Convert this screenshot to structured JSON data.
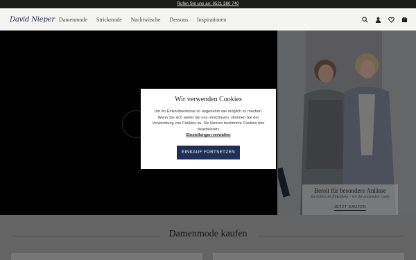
{
  "topbar": {
    "text": "Rufen Sie uns an: 0521 380 740"
  },
  "nav": {
    "logo": "David Nieper",
    "items": [
      "Damenmode",
      "Strickmode",
      "Nachtwäsche",
      "Dessous",
      "Inspirationen"
    ],
    "icons": [
      "search-icon",
      "account-icon",
      "wishlist-icon",
      "cart-icon"
    ]
  },
  "promo": {
    "title": "Bereit für besondere Anlässe",
    "subtitle": "Sie haben die Einladung – wir die passenden Looks",
    "cta": "JETZT KAUFEN"
  },
  "section": {
    "title": "Damenmode kaufen"
  },
  "cookie": {
    "title": "Wir verwenden Cookies",
    "body": "Um Ihr Einkaufserlebnis so angenehm wie möglich zu machen. Wenn Sie sich weiter bei uns umschauen, stimmen Sie der Verwendung von Cookies zu. Sie können bestimmte Cookies hier deaktivieren:",
    "link": "Einstellungen verwalten",
    "button": "EINKAUF FORTSETZEN"
  },
  "colors": {
    "brand": "#1f3057",
    "topbar": "#1b1b1b",
    "overlay": "rgba(0,0,0,0.35)"
  }
}
